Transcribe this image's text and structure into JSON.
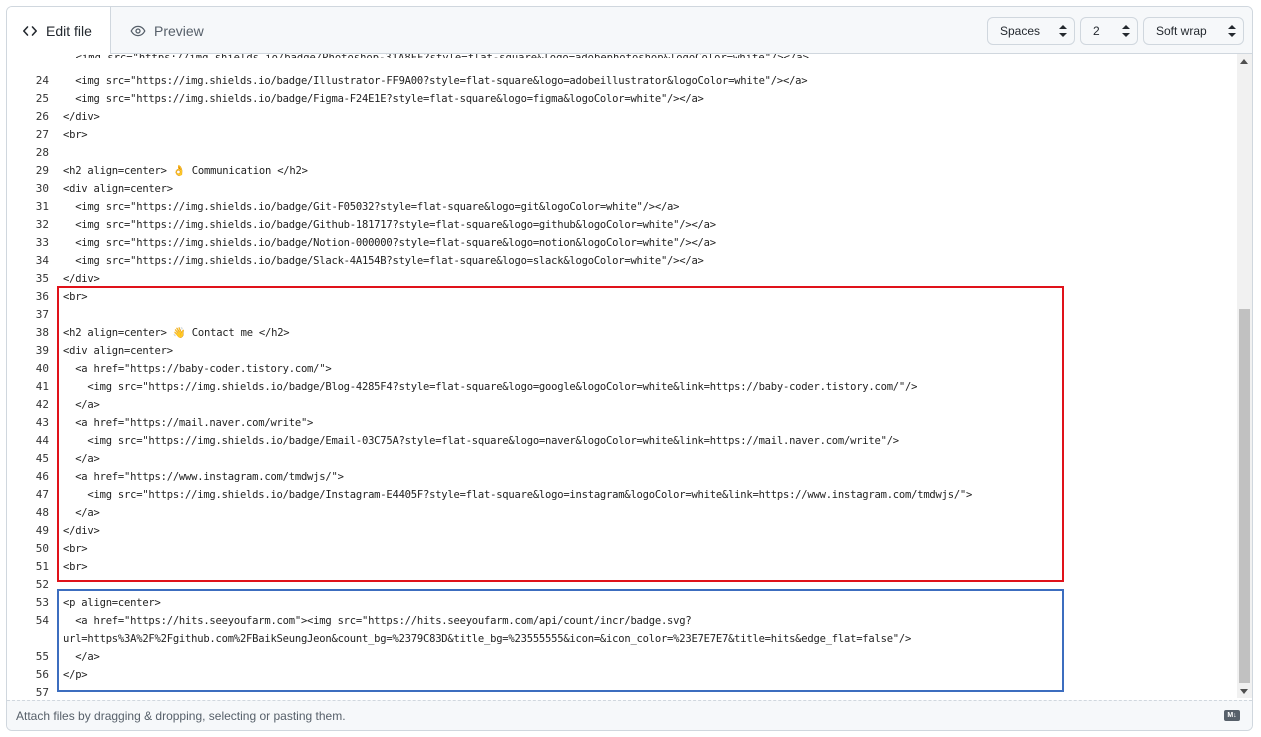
{
  "tabs": [
    {
      "label": "Edit file",
      "icon": "code-icon",
      "active": true
    },
    {
      "label": "Preview",
      "icon": "eye-icon",
      "active": false
    }
  ],
  "controls": {
    "indent_mode": "Spaces",
    "indent_size": "2",
    "wrap_mode": "Soft wrap"
  },
  "editor": {
    "lines": [
      {
        "n": "24",
        "text": "  <img src=\"https://img.shields.io/badge/Illustrator-FF9A00?style=flat-square&logo=adobeillustrator&logoColor=white\"/></a>"
      },
      {
        "n": "25",
        "text": "  <img src=\"https://img.shields.io/badge/Figma-F24E1E?style=flat-square&logo=figma&logoColor=white\"/></a>"
      },
      {
        "n": "26",
        "text": "</div>"
      },
      {
        "n": "27",
        "text": "<br>"
      },
      {
        "n": "28",
        "text": ""
      },
      {
        "n": "29",
        "text": "<h2 align=center> 👌 Communication </h2>"
      },
      {
        "n": "30",
        "text": "<div align=center>"
      },
      {
        "n": "31",
        "text": "  <img src=\"https://img.shields.io/badge/Git-F05032?style=flat-square&logo=git&logoColor=white\"/></a>"
      },
      {
        "n": "32",
        "text": "  <img src=\"https://img.shields.io/badge/Github-181717?style=flat-square&logo=github&logoColor=white\"/></a>"
      },
      {
        "n": "33",
        "text": "  <img src=\"https://img.shields.io/badge/Notion-000000?style=flat-square&logo=notion&logoColor=white\"/></a>"
      },
      {
        "n": "34",
        "text": "  <img src=\"https://img.shields.io/badge/Slack-4A154B?style=flat-square&logo=slack&logoColor=white\"/></a>"
      },
      {
        "n": "35",
        "text": "</div>"
      },
      {
        "n": "36",
        "text": "<br>"
      },
      {
        "n": "37",
        "text": ""
      },
      {
        "n": "38",
        "text": "<h2 align=center> 👋 Contact me </h2>"
      },
      {
        "n": "39",
        "text": "<div align=center>"
      },
      {
        "n": "40",
        "text": "  <a href=\"https://baby-coder.tistory.com/\">"
      },
      {
        "n": "41",
        "text": "    <img src=\"https://img.shields.io/badge/Blog-4285F4?style=flat-square&logo=google&logoColor=white&link=https://baby-coder.tistory.com/\"/>"
      },
      {
        "n": "42",
        "text": "  </a>"
      },
      {
        "n": "43",
        "text": "  <a href=\"https://mail.naver.com/write\">"
      },
      {
        "n": "44",
        "text": "    <img src=\"https://img.shields.io/badge/Email-03C75A?style=flat-square&logo=naver&logoColor=white&link=https://mail.naver.com/write\"/>"
      },
      {
        "n": "45",
        "text": "  </a>"
      },
      {
        "n": "46",
        "text": "  <a href=\"https://www.instagram.com/tmdwjs/\">"
      },
      {
        "n": "47",
        "text": "    <img src=\"https://img.shields.io/badge/Instagram-E4405F?style=flat-square&logo=instagram&logoColor=white&link=https://www.instagram.com/tmdwjs/\">"
      },
      {
        "n": "48",
        "text": "  </a>"
      },
      {
        "n": "49",
        "text": "</div>"
      },
      {
        "n": "50",
        "text": "<br>"
      },
      {
        "n": "51",
        "text": "<br>"
      },
      {
        "n": "52",
        "text": ""
      },
      {
        "n": "53",
        "text": "<p align=center>"
      },
      {
        "n": "54",
        "text": "  <a href=\"https://hits.seeyoufarm.com\"><img src=\"https://hits.seeyoufarm.com/api/count/incr/badge.svg?"
      },
      {
        "n": "",
        "text": "url=https%3A%2F%2Fgithub.com%2FBaikSeungJeon&count_bg=%2379C83D&title_bg=%23555555&icon=&icon_color=%23E7E7E7&title=hits&edge_flat=false\"/>"
      },
      {
        "n": "55",
        "text": "  </a>"
      },
      {
        "n": "56",
        "text": "</p>"
      },
      {
        "n": "57",
        "text": ""
      }
    ]
  },
  "footer": {
    "hint": "Attach files by dragging & dropping, selecting or pasting them.",
    "markdown_badge": "M↓"
  }
}
